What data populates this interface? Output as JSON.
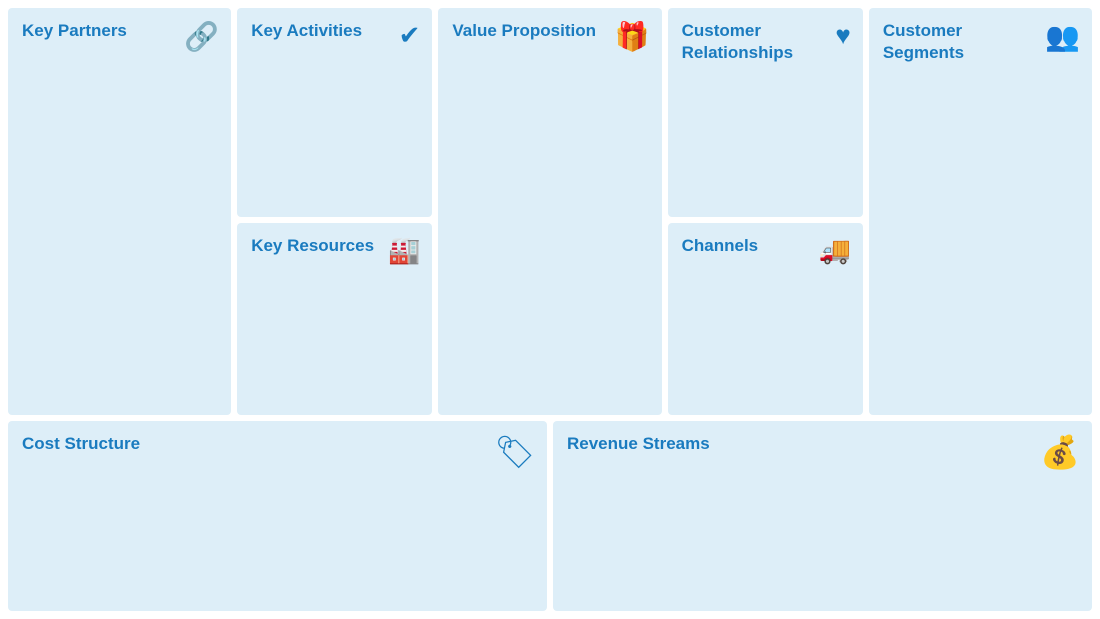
{
  "cells": {
    "key_partners": {
      "title": "Key Partners",
      "icon": "🔗",
      "icon_name": "link-icon"
    },
    "key_activities": {
      "title": "Key Activities",
      "icon": "✔",
      "icon_name": "check-icon"
    },
    "key_resources": {
      "title": "Key Resources",
      "icon": "🏭",
      "icon_name": "factory-icon"
    },
    "value_proposition": {
      "title": "Value Proposition",
      "icon": "🎁",
      "icon_name": "gift-icon"
    },
    "customer_relationships": {
      "title": "Customer Relationships",
      "icon": "❤",
      "icon_name": "heart-icon"
    },
    "channels": {
      "title": "Channels",
      "icon": "🚚",
      "icon_name": "truck-icon"
    },
    "customer_segments": {
      "title": "Customer Segments",
      "icon": "👥",
      "icon_name": "people-icon"
    },
    "cost_structure": {
      "title": "Cost Structure",
      "icon": "🏷",
      "icon_name": "tag-icon"
    },
    "revenue_streams": {
      "title": "Revenue Streams",
      "icon": "💰",
      "icon_name": "money-bag-icon"
    }
  }
}
